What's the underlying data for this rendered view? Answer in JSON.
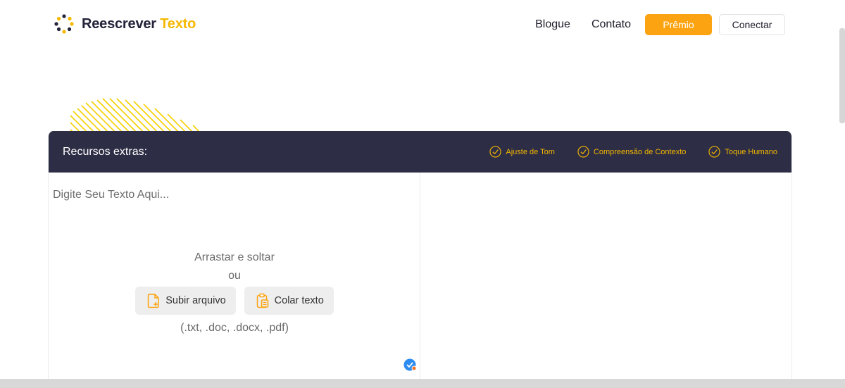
{
  "header": {
    "logo_text_main": "Reescrever",
    "logo_text_accent": "Texto",
    "logo_icon": "dots-circle-logo",
    "nav": {
      "blog_label": "Blogue",
      "contact_label": "Contato",
      "premium_label": "Prêmio",
      "connect_label": "Conectar"
    }
  },
  "panel": {
    "bar_title": "Recursos extras:",
    "features": [
      {
        "label": "Ajuste de Tom",
        "icon": "check-circle-icon"
      },
      {
        "label": "Compreensão de Contexto",
        "icon": "check-circle-icon"
      },
      {
        "label": "Toque Humano",
        "icon": "check-circle-icon"
      }
    ],
    "editor": {
      "placeholder": "Digite Seu Texto Aqui...",
      "drag_drop_label": "Arrastar e soltar",
      "or_label": "ou",
      "upload_label": "Subir arquivo",
      "paste_label": "Colar texto",
      "formats_label": "(.txt, .doc, .docx, .pdf)"
    }
  },
  "colors": {
    "accent": "#f5b800",
    "premium_button": "#fca311",
    "bar_background": "#2d2d45",
    "status_blue": "#2d8cf0",
    "status_dot": "#f37021"
  }
}
